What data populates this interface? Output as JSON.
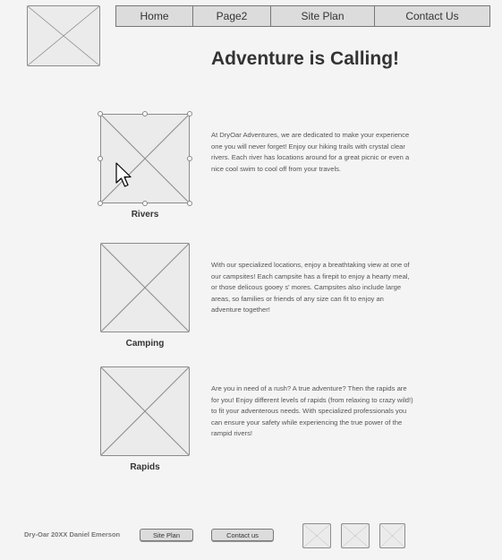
{
  "nav": {
    "items": [
      "Home",
      "Page2",
      "Site Plan",
      "Contact Us"
    ]
  },
  "header": {
    "title": "Adventure is Calling!"
  },
  "sections": [
    {
      "caption": "Rivers",
      "text": "At DryOar Adventures, we are dedicated to make your experience one you will never forget! Enjoy our hiking trails with crystal clear rivers.  Each river has locations around for a great picnic or even a nice cool swim to cool off from your travels."
    },
    {
      "caption": "Camping",
      "text": "With our specialized locations, enjoy a breathtaking view at one of our campsites! Each campsite has a firepit to enjoy a hearty meal, or those delicous gooey s' mores.  Campsites also include large areas, so families or friends of any size can fit to enjoy an adventure together!"
    },
    {
      "caption": "Rapids",
      "text": "Are you in need of a rush? A true adventure?  Then the rapids are for you! Enjoy different levels of rapids (from relaxing to crazy wild!) to fit your adventerous needs.  With specialized professionals you can ensure your safety while experiencing the true power of the rampid rivers!"
    }
  ],
  "footer": {
    "copyright": "Dry-Oar 20XX Daniel Emerson",
    "buttons": [
      "Site Plan",
      "Contact us"
    ]
  },
  "icons": [
    "logo-placeholder-icon",
    "image-placeholder-icon",
    "social-icon",
    "cursor-icon"
  ]
}
